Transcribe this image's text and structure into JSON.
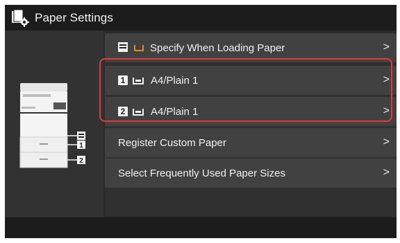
{
  "header": {
    "title": "Paper Settings"
  },
  "menu": {
    "items": [
      {
        "label": "Specify When Loading Paper"
      },
      {
        "label": "A4/Plain 1",
        "tray": "1"
      },
      {
        "label": "A4/Plain 1",
        "tray": "2"
      },
      {
        "label": "Register Custom Paper"
      },
      {
        "label": "Select Frequently Used Paper Sizes"
      }
    ],
    "chevron": ">"
  },
  "printer_diagram": {
    "tray_labels": [
      "1",
      "2"
    ]
  },
  "colors": {
    "highlight": "#e23a3a",
    "background": "#2a2a2a",
    "item": "#414141"
  }
}
